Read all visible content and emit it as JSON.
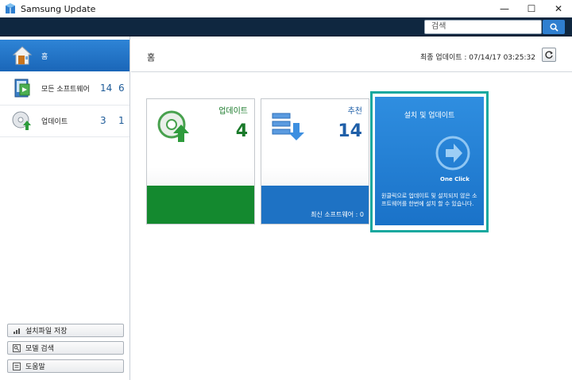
{
  "window": {
    "title": "Samsung Update",
    "minimize": "—",
    "maximize": "☐",
    "close": "✕"
  },
  "search": {
    "placeholder": "검색"
  },
  "sidebar": {
    "items": [
      {
        "label": "홈",
        "count_a": "",
        "count_b": ""
      },
      {
        "label": "모든 소프트웨어",
        "count_a": "14",
        "count_b": "6"
      },
      {
        "label": "업데이트",
        "count_a": "3",
        "count_b": "1"
      }
    ],
    "buttons": [
      {
        "label": "설치파일 저장"
      },
      {
        "label": "모델 검색"
      },
      {
        "label": "도움말"
      }
    ]
  },
  "main": {
    "title": "홈",
    "last_update": "최종 업데이트 : 07/14/17 03:25:32"
  },
  "tiles": {
    "update": {
      "label": "업데이트",
      "count": "4"
    },
    "recommend": {
      "label": "추천",
      "count": "14",
      "bar_text": "최신 소프트웨어 : 0"
    },
    "oneclick": {
      "title": "설치 및 업데이트",
      "subtitle": "One Click",
      "description": "원클릭으로 업데이트 및 설치되지 않은 소프트웨어를 한번에 설치 할 수 있습니다."
    }
  },
  "colors": {
    "header": "#0f2740",
    "accent_blue": "#1a72c8",
    "update_green": "#14892f",
    "highlight_teal": "#16a89f"
  }
}
